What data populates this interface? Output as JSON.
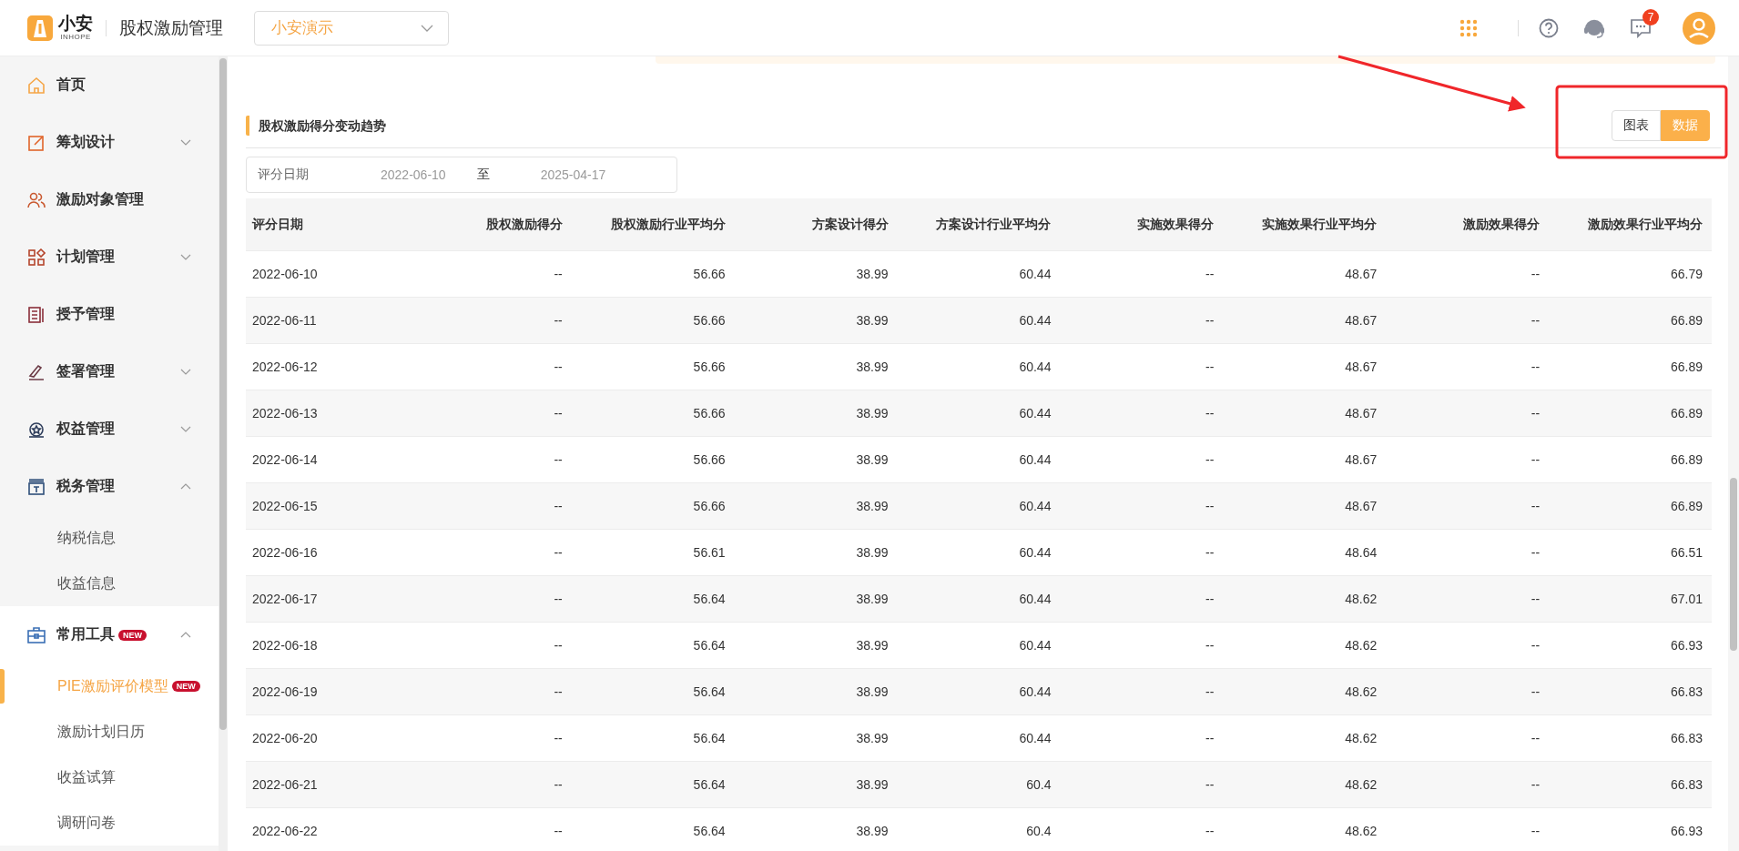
{
  "header": {
    "logo_text": "小安",
    "logo_subtext": "INHOPE",
    "title": "股权激励管理",
    "company_select": {
      "value": "小安演示"
    },
    "message_badge": "7"
  },
  "sidebar": {
    "items": [
      {
        "label": "首页",
        "selected": false
      },
      {
        "label": "筹划设计",
        "selected": false,
        "expanded": false
      },
      {
        "label": "激励对象管理",
        "selected": false
      },
      {
        "label": "计划管理",
        "selected": false,
        "expanded": false
      },
      {
        "label": "授予管理",
        "selected": false
      },
      {
        "label": "签署管理",
        "selected": false,
        "expanded": false
      },
      {
        "label": "权益管理",
        "selected": false,
        "expanded": false
      },
      {
        "label": "税务管理",
        "selected": false,
        "expanded": true,
        "children": [
          {
            "label": "纳税信息",
            "selected": false
          },
          {
            "label": "收益信息",
            "selected": false
          }
        ]
      },
      {
        "label": "常用工具",
        "badge": "NEW",
        "selected": false,
        "expanded": true,
        "children": [
          {
            "label": "PIE激励评价模型",
            "badge": "NEW",
            "selected": true
          },
          {
            "label": "激励计划日历",
            "selected": false
          },
          {
            "label": "收益试算",
            "selected": false
          },
          {
            "label": "调研问卷",
            "selected": false
          }
        ]
      }
    ]
  },
  "section": {
    "title": "股权激励得分变动趋势",
    "view_toggle": [
      {
        "label": "图表",
        "selected": false
      },
      {
        "label": "数据",
        "selected": true
      }
    ]
  },
  "date_filter": {
    "label": "评分日期",
    "start": "2022-06-10",
    "separator": "至",
    "end": "2025-04-17"
  },
  "table": {
    "columns": [
      "评分日期",
      "股权激励得分",
      "股权激励行业平均分",
      "方案设计得分",
      "方案设计行业平均分",
      "实施效果得分",
      "实施效果行业平均分",
      "激励效果得分",
      "激励效果行业平均分"
    ],
    "rows": [
      [
        "2022-06-10",
        "--",
        "56.66",
        "38.99",
        "60.44",
        "--",
        "48.67",
        "--",
        "66.79"
      ],
      [
        "2022-06-11",
        "--",
        "56.66",
        "38.99",
        "60.44",
        "--",
        "48.67",
        "--",
        "66.89"
      ],
      [
        "2022-06-12",
        "--",
        "56.66",
        "38.99",
        "60.44",
        "--",
        "48.67",
        "--",
        "66.89"
      ],
      [
        "2022-06-13",
        "--",
        "56.66",
        "38.99",
        "60.44",
        "--",
        "48.67",
        "--",
        "66.89"
      ],
      [
        "2022-06-14",
        "--",
        "56.66",
        "38.99",
        "60.44",
        "--",
        "48.67",
        "--",
        "66.89"
      ],
      [
        "2022-06-15",
        "--",
        "56.66",
        "38.99",
        "60.44",
        "--",
        "48.67",
        "--",
        "66.89"
      ],
      [
        "2022-06-16",
        "--",
        "56.61",
        "38.99",
        "60.44",
        "--",
        "48.64",
        "--",
        "66.51"
      ],
      [
        "2022-06-17",
        "--",
        "56.64",
        "38.99",
        "60.44",
        "--",
        "48.62",
        "--",
        "67.01"
      ],
      [
        "2022-06-18",
        "--",
        "56.64",
        "38.99",
        "60.44",
        "--",
        "48.62",
        "--",
        "66.93"
      ],
      [
        "2022-06-19",
        "--",
        "56.64",
        "38.99",
        "60.44",
        "--",
        "48.62",
        "--",
        "66.83"
      ],
      [
        "2022-06-20",
        "--",
        "56.64",
        "38.99",
        "60.44",
        "--",
        "48.62",
        "--",
        "66.83"
      ],
      [
        "2022-06-21",
        "--",
        "56.64",
        "38.99",
        "60.4",
        "--",
        "48.62",
        "--",
        "66.83"
      ],
      [
        "2022-06-22",
        "--",
        "56.64",
        "38.99",
        "60.4",
        "--",
        "48.62",
        "--",
        "66.93"
      ]
    ]
  }
}
